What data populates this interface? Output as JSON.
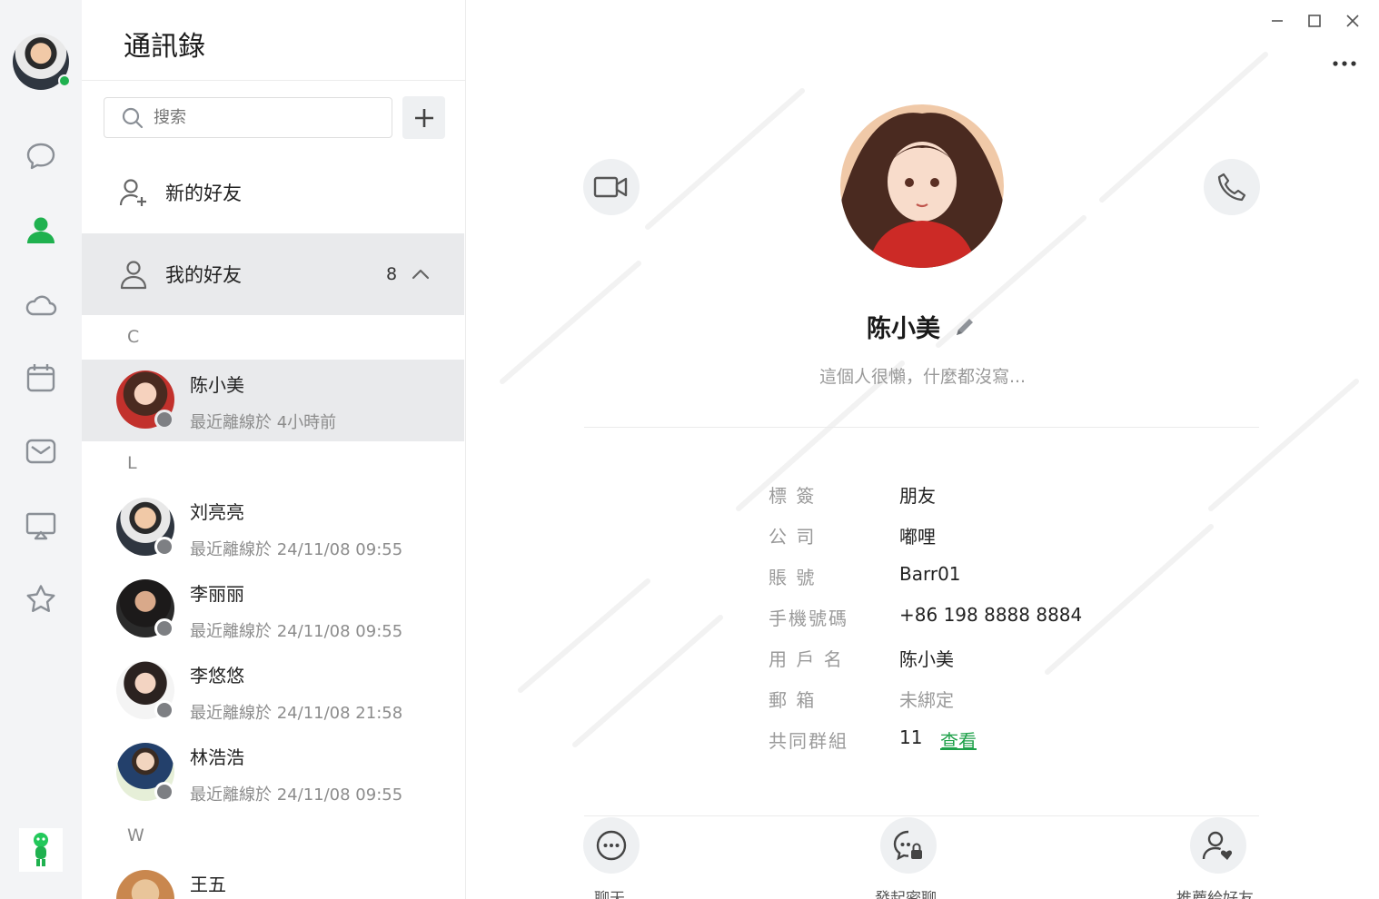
{
  "app": {
    "window_controls": {
      "minimize": "–",
      "maximize": "□",
      "close": "×"
    }
  },
  "rail": {
    "items": [
      {
        "name": "chat",
        "icon": "chat-bubble-icon"
      },
      {
        "name": "contacts",
        "icon": "person-icon",
        "active": true
      },
      {
        "name": "moments",
        "icon": "cloud-icon"
      },
      {
        "name": "calendar",
        "icon": "calendar-icon"
      },
      {
        "name": "mail",
        "icon": "mail-icon"
      },
      {
        "name": "screen-share",
        "icon": "screen-share-icon"
      },
      {
        "name": "favorites",
        "icon": "star-icon"
      }
    ],
    "accent": "#1fb14f"
  },
  "contacts": {
    "title": "通訊錄",
    "search_placeholder": "搜索",
    "new_friends_label": "新的好友",
    "my_friends_label": "我的好友",
    "my_friends_count": "8",
    "groups": [
      {
        "letter": "C",
        "items": [
          {
            "name": "陈小美",
            "last_seen": "最近離線於 4小時前",
            "selected": true
          }
        ]
      },
      {
        "letter": "L",
        "items": [
          {
            "name": "刘亮亮",
            "last_seen": "最近離線於 24/11/08 09:55"
          },
          {
            "name": "李丽丽",
            "last_seen": "最近離線於 24/11/08 09:55"
          },
          {
            "name": "李悠悠",
            "last_seen": "最近離線於 24/11/08 21:58"
          },
          {
            "name": "林浩浩",
            "last_seen": "最近離線於 24/11/08 09:55"
          }
        ]
      },
      {
        "letter": "W",
        "items": [
          {
            "name": "王五",
            "last_seen": ""
          }
        ]
      }
    ]
  },
  "detail": {
    "name": "陈小美",
    "signature": "這個人很懶，什麼都沒寫...",
    "fields": [
      {
        "key": "標 簽",
        "value": "朋友"
      },
      {
        "key": "公 司",
        "value": "嘟哩"
      },
      {
        "key": "賬 號",
        "value": "Barr01"
      },
      {
        "key": "手機號碼",
        "value": "+86 198 8888 8884"
      },
      {
        "key": "用 戶 名",
        "value": "陈小美"
      },
      {
        "key": "郵 箱",
        "value": "未綁定",
        "muted": true
      },
      {
        "key": "共同群組",
        "value": "11",
        "link": "查看"
      }
    ],
    "actions": [
      {
        "label": "聊天",
        "icon": "chat-icon"
      },
      {
        "label": "發起密聊",
        "icon": "secret-chat-icon"
      },
      {
        "label": "推薦給好友",
        "icon": "recommend-friend-icon"
      }
    ]
  }
}
